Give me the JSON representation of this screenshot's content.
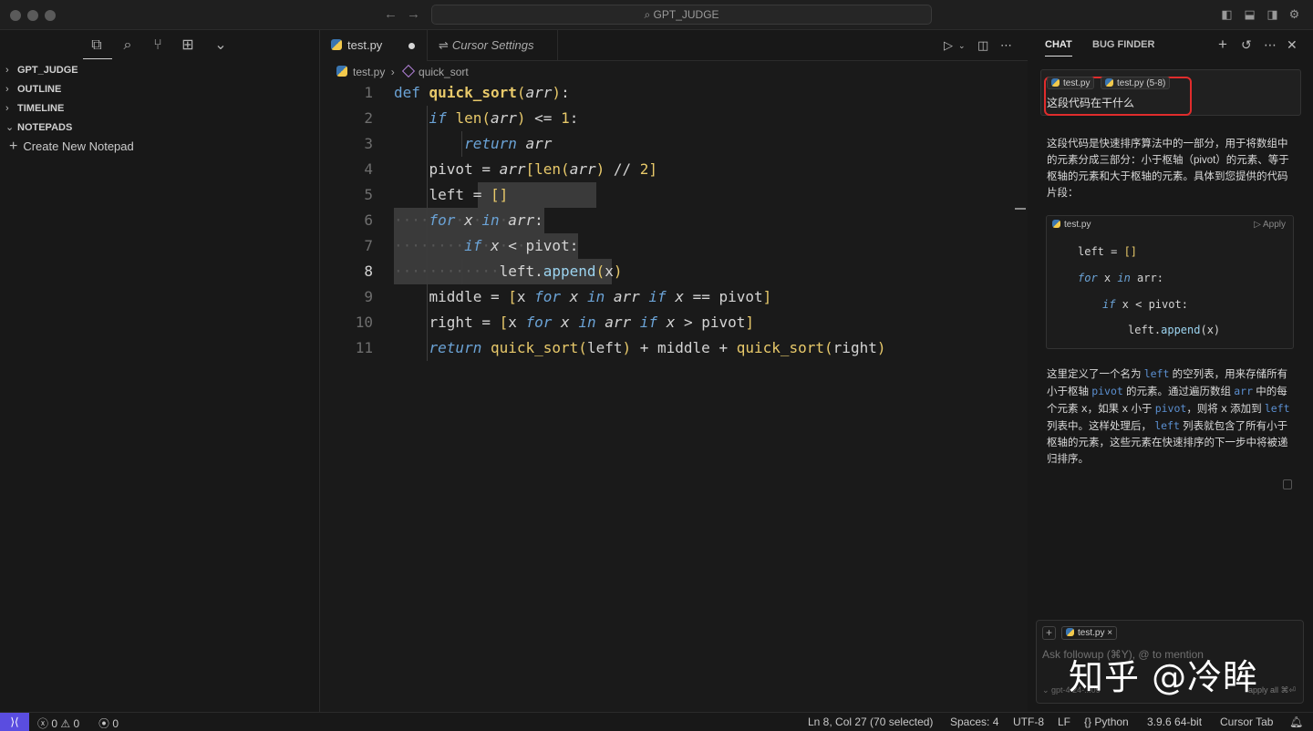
{
  "window": {
    "title": "GPT_JUDGE"
  },
  "sidebar": {
    "sections": [
      {
        "label": "GPT_JUDGE",
        "expanded": false
      },
      {
        "label": "OUTLINE",
        "expanded": false
      },
      {
        "label": "TIMELINE",
        "expanded": false
      },
      {
        "label": "NOTEPADS",
        "expanded": true
      }
    ],
    "create_notepad": "Create New Notepad"
  },
  "editor": {
    "tabs": [
      {
        "label": "test.py",
        "modified": true
      },
      {
        "label": "Cursor Settings"
      }
    ],
    "breadcrumb": {
      "file": "test.py",
      "symbol": "quick_sort"
    },
    "line_numbers": [
      "1",
      "2",
      "3",
      "4",
      "5",
      "6",
      "7",
      "8",
      "9",
      "10",
      "11"
    ],
    "current_line": "8"
  },
  "chat": {
    "tabs": {
      "chat": "CHAT",
      "bug_finder": "BUG FINDER"
    },
    "question": {
      "pills": [
        "test.py",
        "test.py (5-8)"
      ],
      "text": "这段代码在干什么"
    },
    "answer_intro": "这段代码是快速排序算法中的一部分，用于将数组中的元素分成三部分：小于枢轴（pivot）的元素、等于枢轴的元素和大于枢轴的元素。具体到您提供的代码片段：",
    "codeblock": {
      "file": "test.py",
      "apply": "Apply",
      "lines": [
        "left = []",
        "for x in arr:",
        "if x < pivot:",
        "left.append(x)"
      ]
    },
    "explanation": {
      "p1": "这里定义了一个名为",
      "c1": "left",
      "p2": "的空列表，用来存储所有小于枢轴",
      "c2": "pivot",
      "p3": "的元素。通过遍历数组",
      "c3": "arr",
      "p4": "中的每个元素",
      "c4": "x",
      "p5": "，如果",
      "c5": "x",
      "p6": "小于",
      "c6": "pivot",
      "p7": "，则将",
      "c7": "x",
      "p8": "添加到",
      "c8": "left",
      "p9": "列表中。这样处理后，",
      "c9": "left",
      "p10": "列表就包含了所有小于枢轴的元素，这些元素在快速排序的下一步中将被递归排序。"
    },
    "input": {
      "pill": "test.py",
      "placeholder": "Ask followup (⌘Y), @ to mention",
      "model": "gpt-4",
      "model_suffix": "24-...09",
      "apply_all": "apply all ⌘⏎"
    },
    "watermark": "知乎 @冷眸"
  },
  "statusbar": {
    "errors": "0",
    "warnings": "0",
    "ports": "0",
    "position": "Ln 8, Col 27 (70 selected)",
    "spaces": "Spaces: 4",
    "encoding": "UTF-8",
    "eol": "LF",
    "language": "Python",
    "interpreter": "3.9.6 64-bit",
    "cursor_tab": "Cursor Tab"
  }
}
